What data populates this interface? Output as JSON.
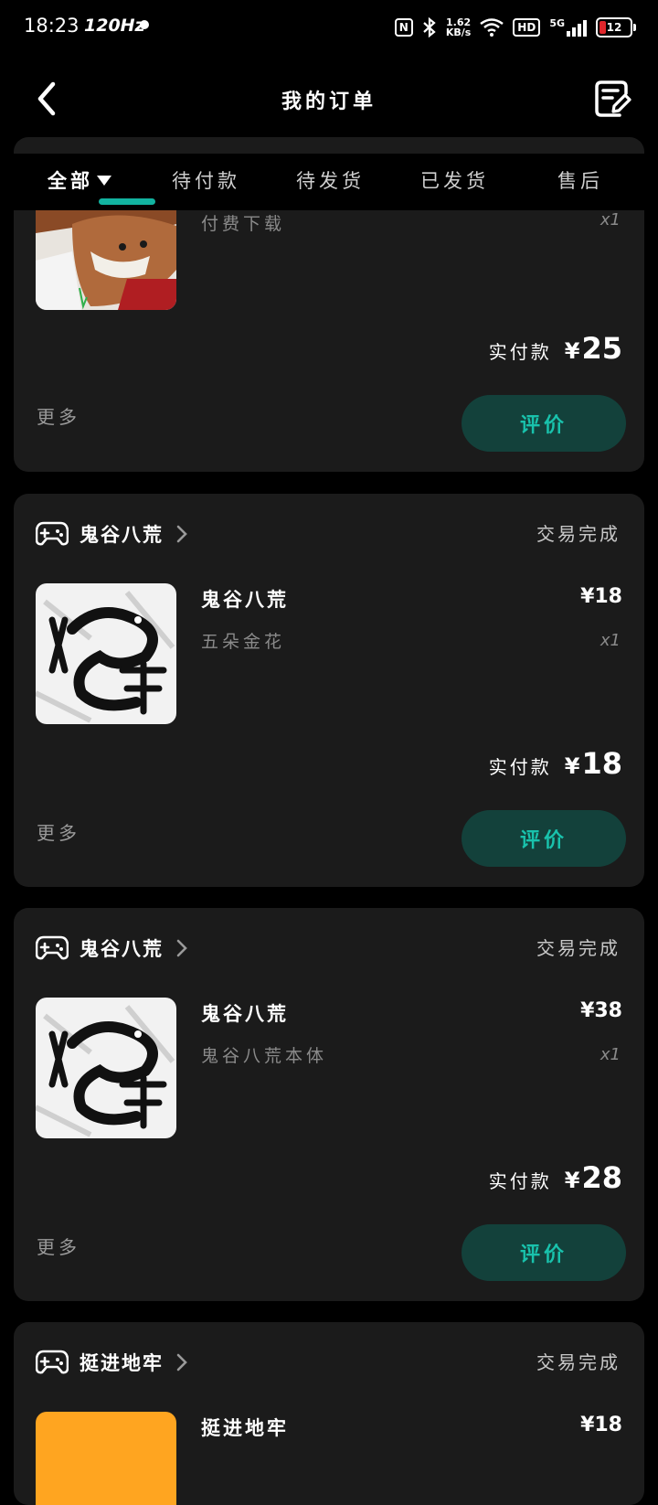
{
  "status_bar": {
    "time": "18:23",
    "refresh": "120Hz",
    "nfc": "N",
    "speed_top": "1.62",
    "speed_bottom": "KB/s",
    "hd": "HD",
    "network": "5G",
    "battery": "12"
  },
  "header": {
    "title": "我的订单"
  },
  "tabs": [
    {
      "label": "全部",
      "active": true
    },
    {
      "label": "待付款"
    },
    {
      "label": "待发货"
    },
    {
      "label": "已发货"
    },
    {
      "label": "售后"
    }
  ],
  "orders": [
    {
      "product_sub": "付费下载",
      "qty": "x1",
      "paid_label": "实付款",
      "currency": "¥",
      "paid_amount": "25",
      "more": "更多",
      "action": "评价"
    },
    {
      "store": "鬼谷八荒",
      "status": "交易完成",
      "product_title": "鬼谷八荒",
      "product_sub": "五朵金花",
      "price": "¥18",
      "qty": "x1",
      "paid_label": "实付款",
      "currency": "¥",
      "paid_amount": "18",
      "more": "更多",
      "action": "评价"
    },
    {
      "store": "鬼谷八荒",
      "status": "交易完成",
      "product_title": "鬼谷八荒",
      "product_sub": "鬼谷八荒本体",
      "price": "¥38",
      "qty": "x1",
      "paid_label": "实付款",
      "currency": "¥",
      "paid_amount": "28",
      "more": "更多",
      "action": "评价"
    },
    {
      "store": "挺进地牢",
      "status": "交易完成",
      "product_title": "挺进地牢",
      "price": "¥18"
    }
  ],
  "icons": {
    "back": "chevron-left-icon",
    "edit": "edit-note-icon",
    "store": "gamepad-icon",
    "chevron": "chevron-right-icon"
  },
  "colors": {
    "accent": "#12b3a0",
    "button_bg": "#13413b",
    "card_bg": "#1b1b1b",
    "thumb_orange": "#ffa520"
  }
}
